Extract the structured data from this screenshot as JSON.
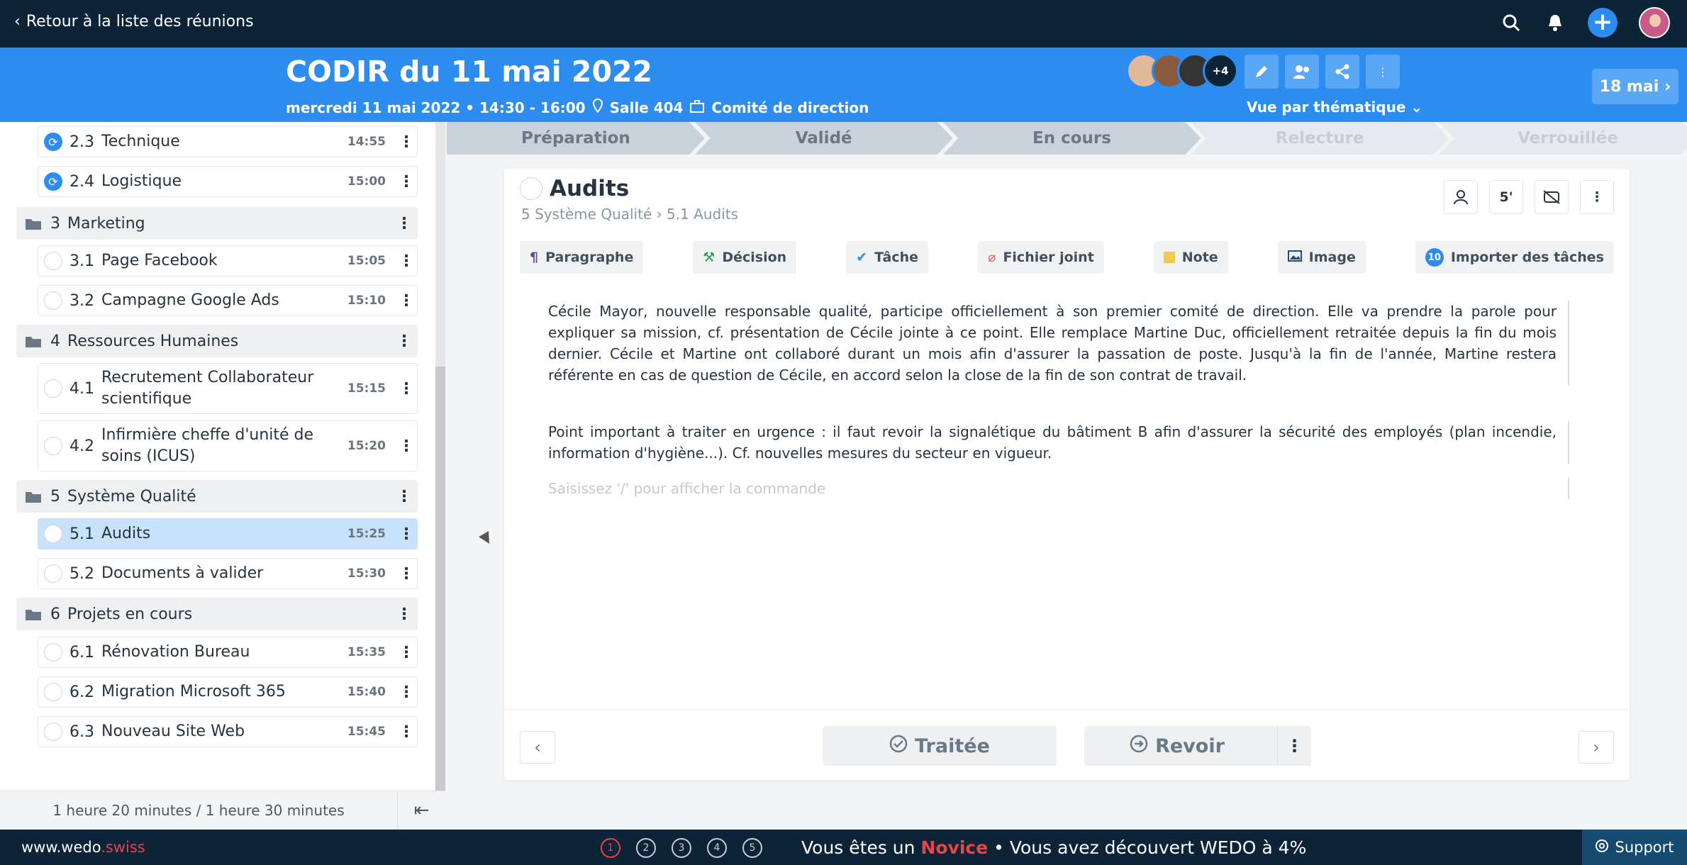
{
  "topbar": {
    "back_label": "Retour à la liste des réunions"
  },
  "header": {
    "title": "CODIR du 11 mai 2022",
    "datetime": "mercredi 11 mai 2022 • 14:30 - 16:00",
    "room": "Salle 404",
    "committee": "Comité de direction",
    "attendees_more": "+4",
    "view_by": "Vue par thématique",
    "next_meeting": "18 mai"
  },
  "agenda": {
    "items": [
      {
        "num": "2.3",
        "title": "Technique",
        "time": "14:55"
      },
      {
        "num": "2.4",
        "title": "Logistique",
        "time": "15:00"
      },
      {
        "num": "3.1",
        "title": "Page Facebook",
        "time": "15:05"
      },
      {
        "num": "3.2",
        "title": "Campagne Google Ads",
        "time": "15:10"
      },
      {
        "num": "4.1",
        "title": "Recrutement Collaborateur scientifique",
        "time": "15:15"
      },
      {
        "num": "4.2",
        "title": "Infirmière cheffe d'unité de soins (ICUS)",
        "time": "15:20"
      },
      {
        "num": "5.1",
        "title": "Audits",
        "time": "15:25"
      },
      {
        "num": "5.2",
        "title": "Documents à valider",
        "time": "15:30"
      },
      {
        "num": "6.1",
        "title": "Rénovation Bureau",
        "time": "15:35"
      },
      {
        "num": "6.2",
        "title": "Migration Microsoft 365",
        "time": "15:40"
      },
      {
        "num": "6.3",
        "title": "Nouveau Site Web",
        "time": "15:45"
      }
    ],
    "sections": [
      {
        "num": "3",
        "title": "Marketing"
      },
      {
        "num": "4",
        "title": "Ressources Humaines"
      },
      {
        "num": "5",
        "title": "Système Qualité"
      },
      {
        "num": "6",
        "title": "Projets en cours"
      }
    ],
    "duration": "1 heure 20 minutes / 1 heure 30 minutes"
  },
  "steps": [
    "Préparation",
    "Validé",
    "En cours",
    "Relecture",
    "Verrouillée"
  ],
  "topic": {
    "title": "Audits",
    "breadcrumb": "5 Système Qualité › 5.1 Audits",
    "duration": "5'",
    "blocks": [
      "Paragraphe",
      "Décision",
      "Tâche",
      "Fichier joint",
      "Note",
      "Image",
      "Importer des tâches"
    ],
    "import_count": "10",
    "paragraph1": "Cécile Mayor, nouvelle responsable qualité, participe officiellement à son premier comité de direction. Elle va prendre la parole pour expliquer sa mission, cf. présentation de Cécile jointe à ce point. Elle remplace Martine Duc, officiellement retraitée depuis la fin du mois dernier. Cécile et Martine ont collaboré durant un mois afin d'assurer la passation de poste. Jusqu'à la fin de l'année, Martine restera référente en cas de question de Cécile, en accord selon la close de la fin de son contrat de travail.",
    "paragraph2": "Point important à traiter en urgence : il faut revoir la signalétique du bâtiment B afin d'assurer la sécurité des employés (plan incendie, information d'hygiène...). Cf. nouvelles mesures du secteur en vigueur.",
    "placeholder": "Saisissez '/' pour afficher la commande",
    "treated_label": "Traitée",
    "review_label": "Revoir"
  },
  "bottombar": {
    "site_prefix": "www.wedo",
    "site_suffix": ".swiss",
    "levels": [
      "1",
      "2",
      "3",
      "4",
      "5"
    ],
    "msg_prefix": "Vous êtes un",
    "msg_level": "Novice",
    "msg_suffix": "• Vous avez découvert WEDO à 4%",
    "support": "Support"
  }
}
